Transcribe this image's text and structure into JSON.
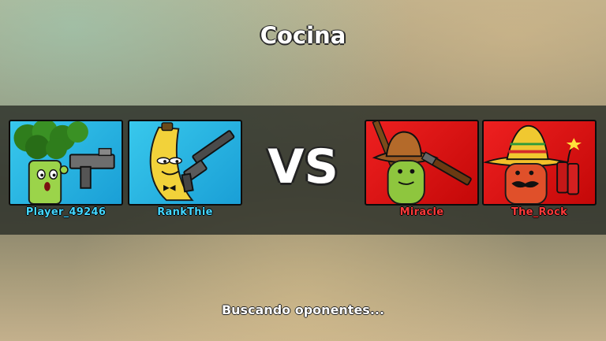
{
  "map_title": "Cocina",
  "versus_label": "VS",
  "status_text": "Buscando oponentes...",
  "teams": {
    "left": {
      "color": "#43d6ff",
      "players": [
        {
          "name": "Player_49246",
          "avatar": "broccoli-with-uzi-icon"
        },
        {
          "name": "RankThie",
          "avatar": "banana-with-silenced-pistol-icon"
        }
      ]
    },
    "right": {
      "color": "#ff3a3a",
      "players": [
        {
          "name": "Miracle",
          "avatar": "pickle-cowboy-with-rifle-icon"
        },
        {
          "name": "The_Rock",
          "avatar": "chili-sombrero-with-dynamite-icon"
        }
      ]
    }
  }
}
